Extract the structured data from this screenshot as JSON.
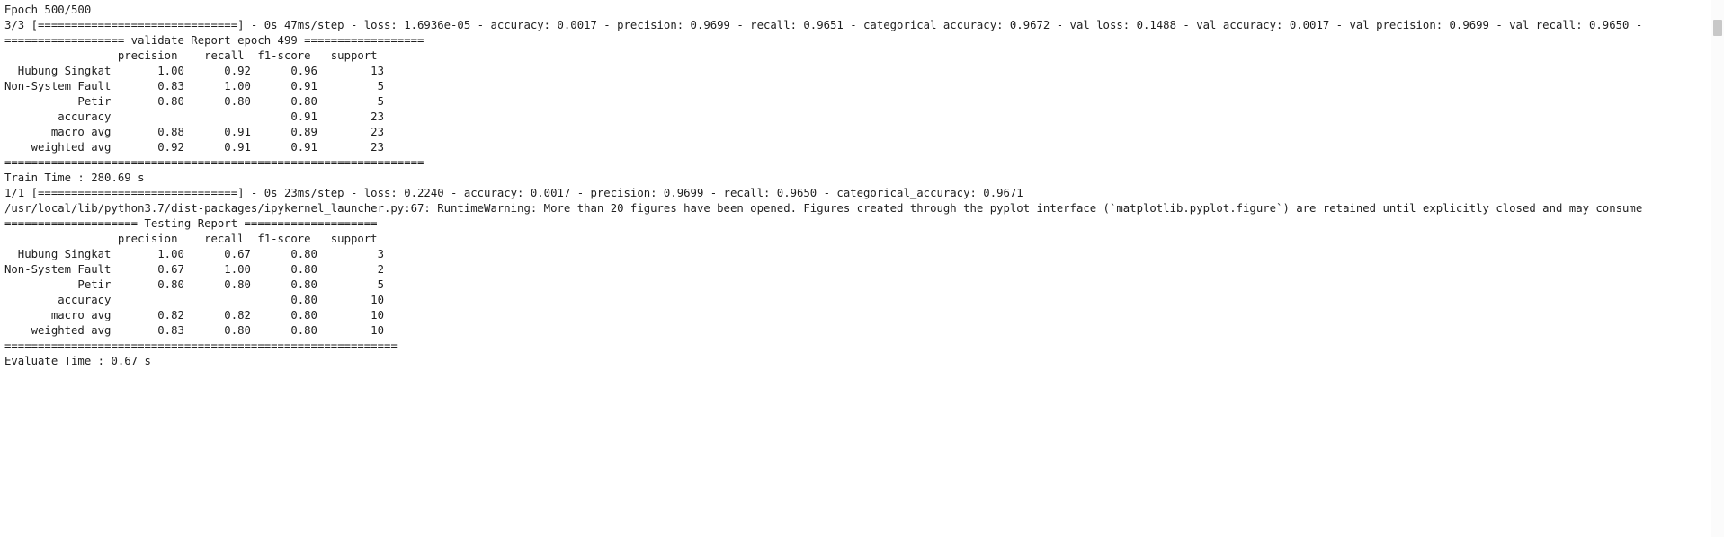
{
  "output": {
    "lines": [
      "",
      "Epoch 500/500",
      "3/3 [==============================] - 0s 47ms/step - loss: 1.6936e-05 - accuracy: 0.0017 - precision: 0.9699 - recall: 0.9651 - categorical_accuracy: 0.9672 - val_loss: 0.1488 - val_accuracy: 0.0017 - val_precision: 0.9699 - val_recall: 0.9650 -",
      "",
      "================== validate Report epoch 499 ==================",
      "                 precision    recall  f1-score   support",
      "",
      "  Hubung Singkat       1.00      0.92      0.96        13",
      "Non-System Fault       0.83      1.00      0.91         5",
      "           Petir       0.80      0.80      0.80         5",
      "",
      "        accuracy                           0.91        23",
      "       macro avg       0.88      0.91      0.89        23",
      "    weighted avg       0.92      0.91      0.91        23",
      "",
      "===============================================================",
      "",
      "Train Time : 280.69 s",
      "1/1 [==============================] - 0s 23ms/step - loss: 0.2240 - accuracy: 0.0017 - precision: 0.9699 - recall: 0.9650 - categorical_accuracy: 0.9671",
      "/usr/local/lib/python3.7/dist-packages/ipykernel_launcher.py:67: RuntimeWarning: More than 20 figures have been opened. Figures created through the pyplot interface (`matplotlib.pyplot.figure`) are retained until explicitly closed and may consume",
      "",
      "==================== Testing Report ====================",
      "                 precision    recall  f1-score   support",
      "",
      "  Hubung Singkat       1.00      0.67      0.80         3",
      "Non-System Fault       0.67      1.00      0.80         2",
      "           Petir       0.80      0.80      0.80         5",
      "",
      "        accuracy                           0.80        10",
      "       macro avg       0.82      0.82      0.80        10",
      "    weighted avg       0.83      0.80      0.80        10",
      "",
      "===========================================================",
      "",
      "Evaluate Time : 0.67 s"
    ]
  }
}
